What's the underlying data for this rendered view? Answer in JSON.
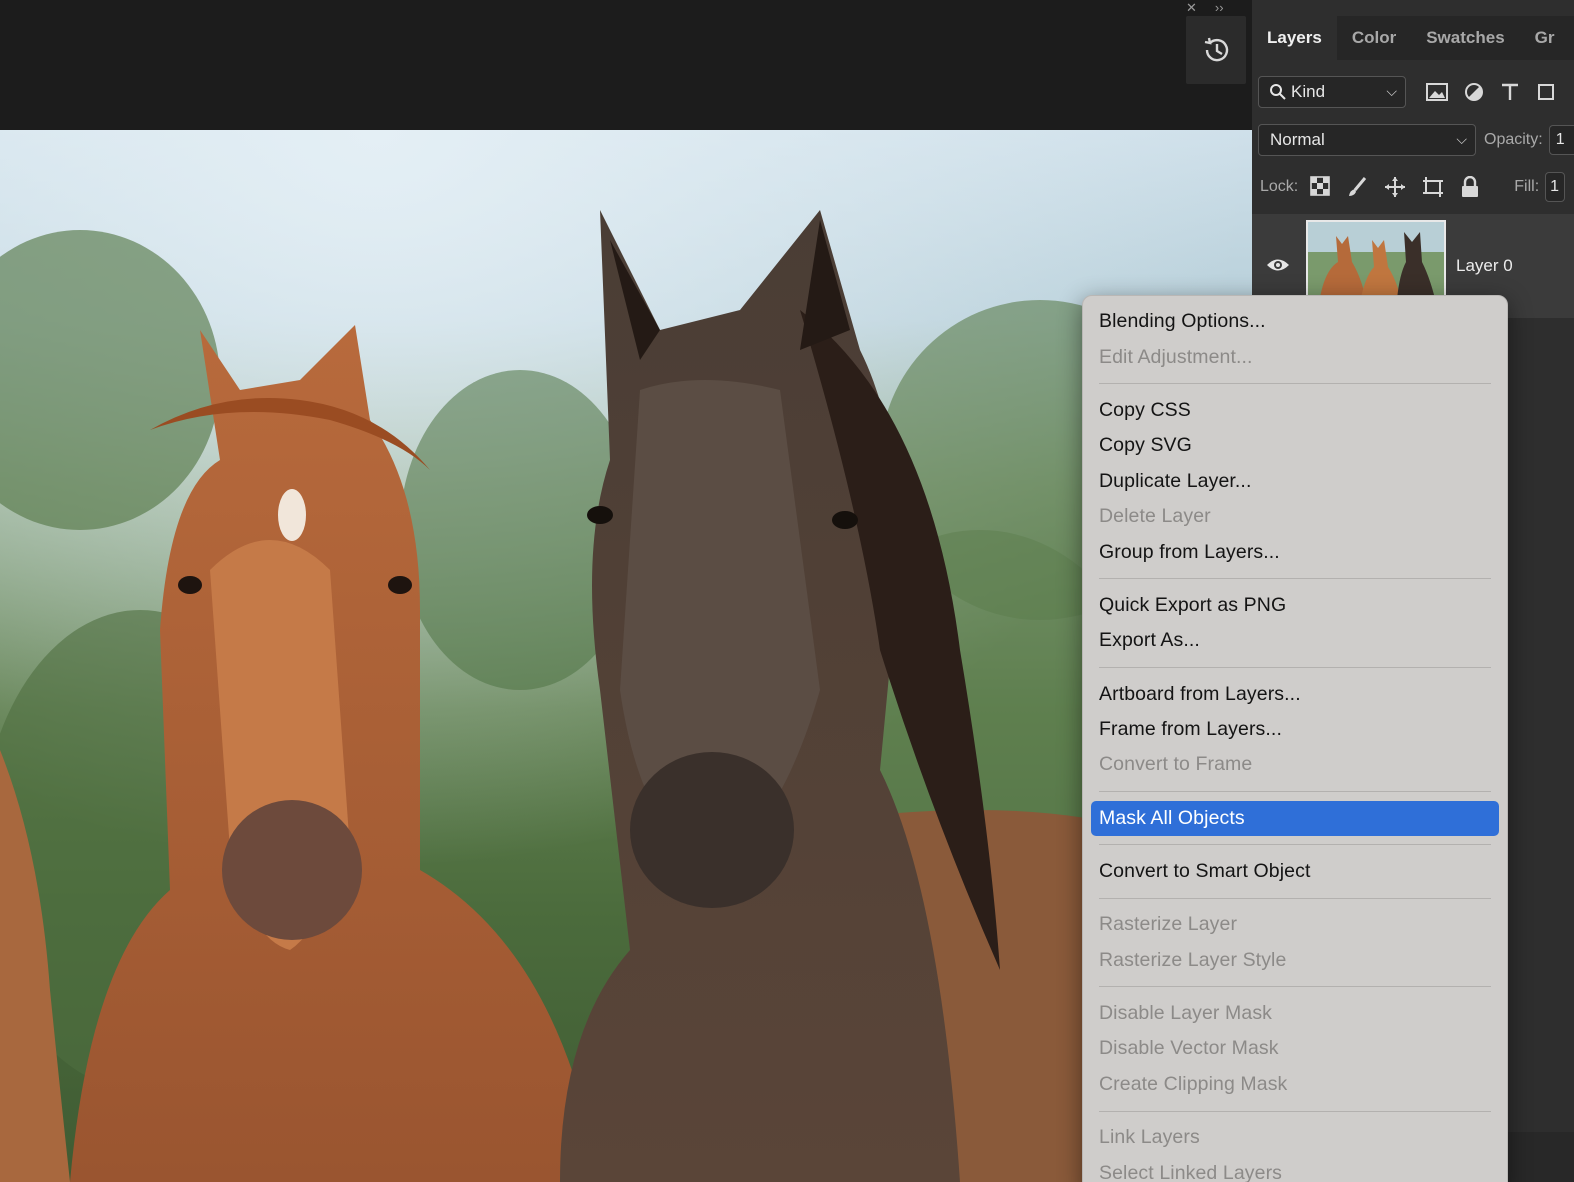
{
  "panel_controls": {
    "close": "✕",
    "expand": "››"
  },
  "tabs": [
    "Layers",
    "Color",
    "Swatches",
    "Gr"
  ],
  "filter": {
    "kind_label": "Kind"
  },
  "blend": {
    "mode": "Normal",
    "opacity_label": "Opacity:",
    "opacity_value": "1"
  },
  "lock": {
    "label": "Lock:",
    "fill_label": "Fill:",
    "fill_value": "1"
  },
  "layer": {
    "name": "Layer 0"
  },
  "context_menu": {
    "groups": [
      [
        {
          "label": "Blending Options...",
          "enabled": true
        },
        {
          "label": "Edit Adjustment...",
          "enabled": false
        }
      ],
      [
        {
          "label": "Copy CSS",
          "enabled": true
        },
        {
          "label": "Copy SVG",
          "enabled": true
        },
        {
          "label": "Duplicate Layer...",
          "enabled": true
        },
        {
          "label": "Delete Layer",
          "enabled": false
        },
        {
          "label": "Group from Layers...",
          "enabled": true
        }
      ],
      [
        {
          "label": "Quick Export as PNG",
          "enabled": true
        },
        {
          "label": "Export As...",
          "enabled": true
        }
      ],
      [
        {
          "label": "Artboard from Layers...",
          "enabled": true
        },
        {
          "label": "Frame from Layers...",
          "enabled": true
        },
        {
          "label": "Convert to Frame",
          "enabled": false
        }
      ],
      [
        {
          "label": "Mask All Objects",
          "enabled": true,
          "highlighted": true
        }
      ],
      [
        {
          "label": "Convert to Smart Object",
          "enabled": true
        }
      ],
      [
        {
          "label": "Rasterize Layer",
          "enabled": false
        },
        {
          "label": "Rasterize Layer Style",
          "enabled": false
        }
      ],
      [
        {
          "label": "Disable Layer Mask",
          "enabled": false
        },
        {
          "label": "Disable Vector Mask",
          "enabled": false
        },
        {
          "label": "Create Clipping Mask",
          "enabled": false
        }
      ],
      [
        {
          "label": "Link Layers",
          "enabled": false
        },
        {
          "label": "Select Linked Layers",
          "enabled": false
        }
      ]
    ],
    "highlight_color": "#2f6fd8"
  }
}
